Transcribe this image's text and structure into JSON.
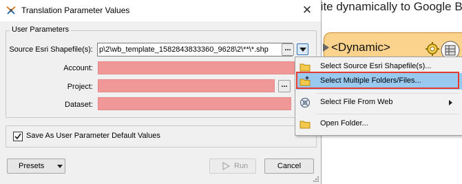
{
  "dialog": {
    "title": "Translation Parameter Values",
    "close_glyph": "✕",
    "group_title": "User Parameters",
    "params": [
      {
        "label": "Source Esri Shapefile(s):",
        "value": "p\\2\\wb_template_1582843833360_9628\\2\\**\\*.shp"
      },
      {
        "label": "Account:",
        "value": ""
      },
      {
        "label": "Project:",
        "value": ""
      },
      {
        "label": "Dataset:",
        "value": ""
      }
    ],
    "ellipsis": "...",
    "save_default_label": "Save As User Parameter Default Values",
    "save_default_checked": true,
    "presets_label": "Presets",
    "run_label": "Run",
    "cancel_label": "Cancel"
  },
  "menu": {
    "items": [
      {
        "label": "Select Source Esri Shapefile(s)...",
        "icon": "folder-icon"
      },
      {
        "label": "Select Multiple Folders/Files...",
        "icon": "folder-add-icon"
      },
      {
        "label": "Select File From Web",
        "icon": "web-icon"
      },
      {
        "label": "Open Folder...",
        "icon": "folder-icon"
      }
    ]
  },
  "background": {
    "heading": "rite dynamically to Google B",
    "node_title": "<Dynamic>"
  },
  "colors": {
    "required_field": "#f09898",
    "menu_highlight": "#99c9ef",
    "callout_border": "#e53a2e",
    "node_fill": "#fbd38d"
  }
}
